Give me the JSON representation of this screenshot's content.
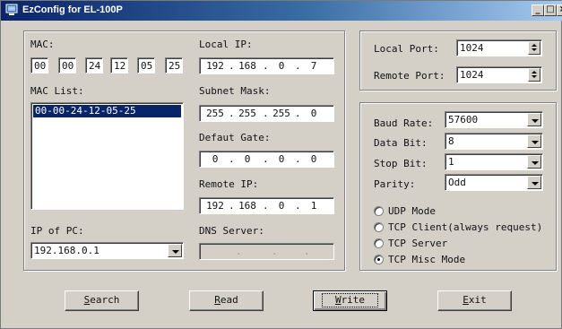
{
  "window": {
    "title": "EzConfig for EL-100P"
  },
  "mac": {
    "label": "MAC:",
    "octets": [
      "00",
      "00",
      "24",
      "12",
      "05",
      "25"
    ]
  },
  "mac_list": {
    "label": "MAC List:",
    "items": [
      "00-00-24-12-05-25"
    ]
  },
  "pc_ip": {
    "label": "IP of PC:",
    "value": "192.168.0.1"
  },
  "local_ip": {
    "label": "Local IP:",
    "octets": [
      "192",
      "168",
      "0",
      "7"
    ]
  },
  "subnet_mask": {
    "label": "Subnet Mask:",
    "octets": [
      "255",
      "255",
      "255",
      "0"
    ]
  },
  "gateway": {
    "label": "Defaut Gate:",
    "octets": [
      "0",
      "0",
      "0",
      "0"
    ]
  },
  "remote_ip": {
    "label": "Remote IP:",
    "octets": [
      "192",
      "168",
      "0",
      "1"
    ]
  },
  "dns": {
    "label": "DNS Server:"
  },
  "ports": {
    "local_label": "Local Port:",
    "local_value": "1024",
    "remote_label": "Remote Port:",
    "remote_value": "1024"
  },
  "serial": {
    "baud_label": "Baud Rate:",
    "baud_value": "57600",
    "databit_label": "Data Bit:",
    "databit_value": "8",
    "stopbit_label": "Stop Bit:",
    "stopbit_value": "1",
    "parity_label": "Parity:",
    "parity_value": "Odd"
  },
  "modes": {
    "udp": "UDP Mode",
    "tcp_client": "TCP Client(always request)",
    "tcp_server": "TCP Server",
    "tcp_misc": "TCP Misc Mode",
    "selected": "tcp_misc"
  },
  "buttons": {
    "search_u": "S",
    "search_rest": "earch",
    "read_u": "R",
    "read_rest": "ead",
    "write_u": "W",
    "write_rest": "rite",
    "exit_u": "E",
    "exit_rest": "xit"
  }
}
